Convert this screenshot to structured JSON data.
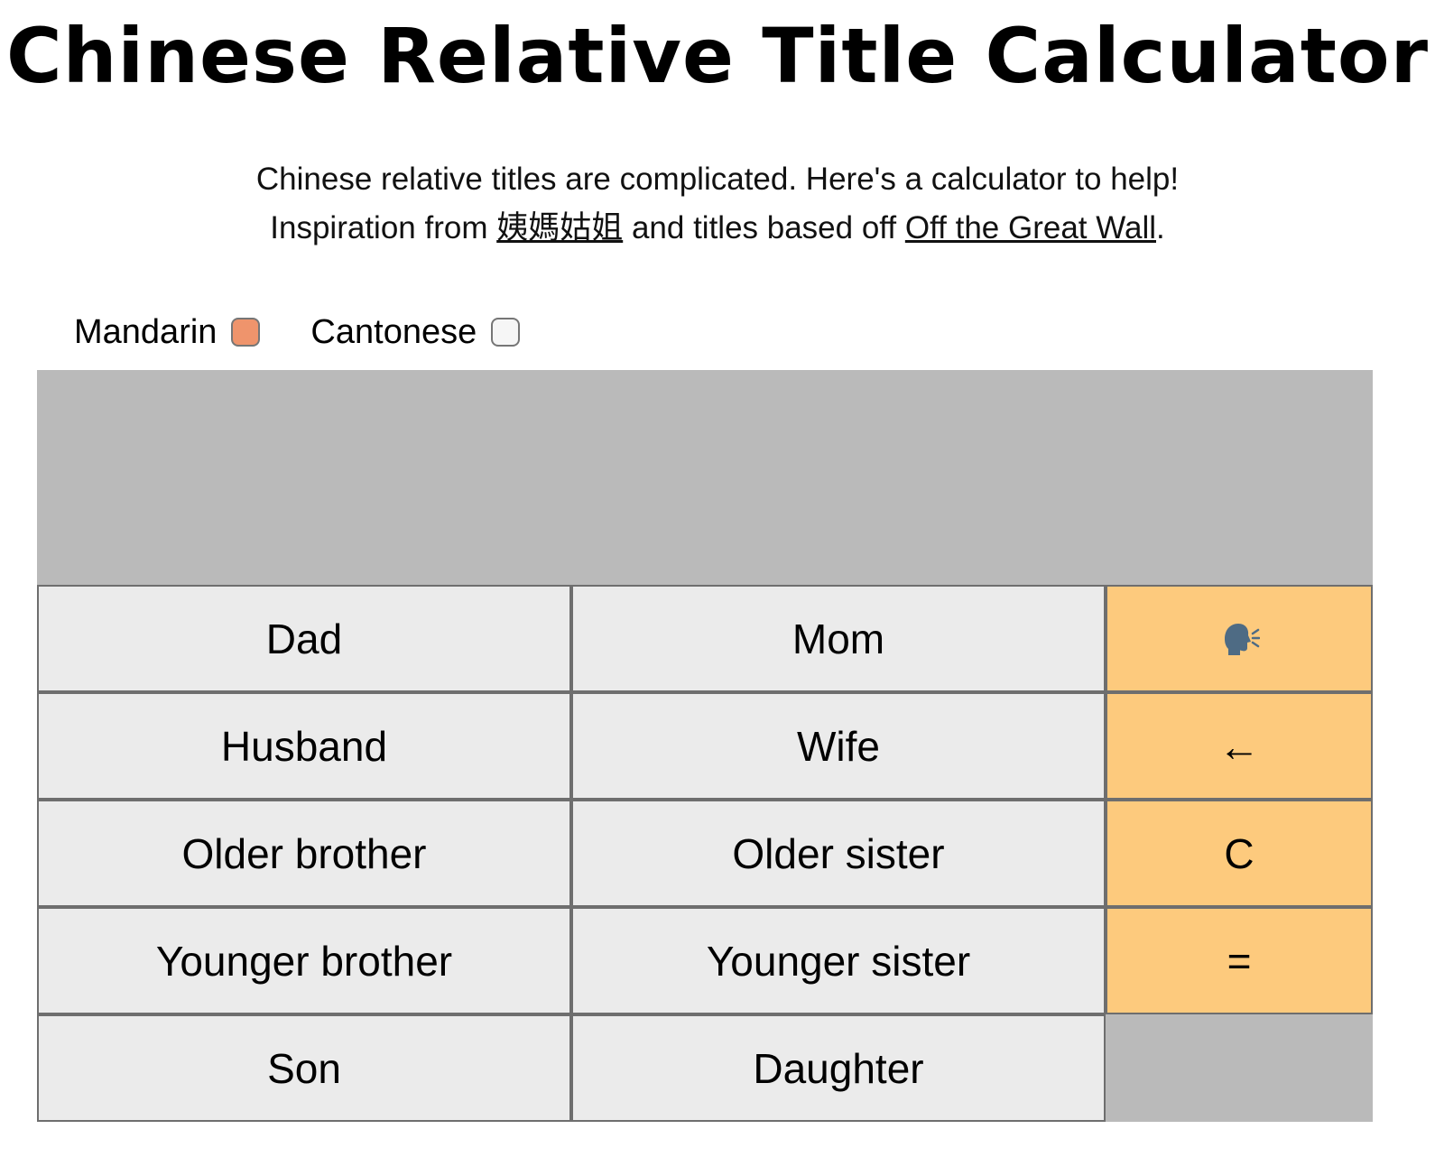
{
  "page": {
    "title": "Chinese Relative Title Calculator",
    "intro_line1": "Chinese relative titles are complicated. Here's a calculator to help!",
    "intro_line2_prefix": "Inspiration from ",
    "inspiration_link": "姨媽姑姐",
    "intro_line2_middle": " and titles based off ",
    "source_link": "Off the Great Wall",
    "intro_line2_suffix": "."
  },
  "languages": [
    {
      "label": "Mandarin",
      "checked": true
    },
    {
      "label": "Cantonese",
      "checked": false
    }
  ],
  "display": {
    "value": ""
  },
  "keys": {
    "dad": "Dad",
    "mom": "Mom",
    "husband": "Husband",
    "wife": "Wife",
    "older_brother": "Older brother",
    "older_sister": "Older sister",
    "younger_brother": "Younger brother",
    "younger_sister": "Younger sister",
    "son": "Son",
    "daughter": "Daughter",
    "backspace": "←",
    "clear": "C",
    "equals": "="
  },
  "icons": {
    "speak": "speaking-head-icon"
  },
  "colors": {
    "display_bg": "#bababa",
    "relation_key_bg": "#ebebeb",
    "function_key_bg": "#fdca7d",
    "checked_checkbox": "#ef946c"
  }
}
